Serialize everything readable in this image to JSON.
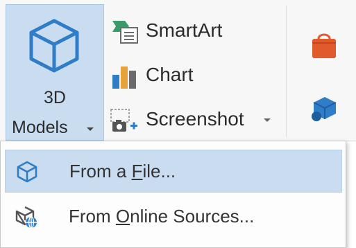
{
  "ribbon": {
    "models_button": {
      "line1": "3D",
      "line2": "Models",
      "icon": "cube-icon"
    },
    "smartart": {
      "label": "SmartArt",
      "icon": "smartart-icon"
    },
    "chart": {
      "label": "Chart",
      "icon": "bar-chart-icon"
    },
    "screenshot": {
      "label": "Screenshot",
      "icon": "camera-plus-icon"
    },
    "store_icon": "store-bag-icon",
    "my_addins_icon": "addins-cubes-icon"
  },
  "menu": {
    "items": [
      {
        "label_pre": "From a ",
        "label_access": "F",
        "label_post": "ile...",
        "icon": "cube-icon"
      },
      {
        "label_pre": "From ",
        "label_access": "O",
        "label_post": "nline Sources...",
        "icon": "cube-globe-icon"
      }
    ]
  },
  "colors": {
    "highlight": "#c9dcf0",
    "icon_blue": "#2f7dc6",
    "store_orange": "#e05a2b"
  }
}
